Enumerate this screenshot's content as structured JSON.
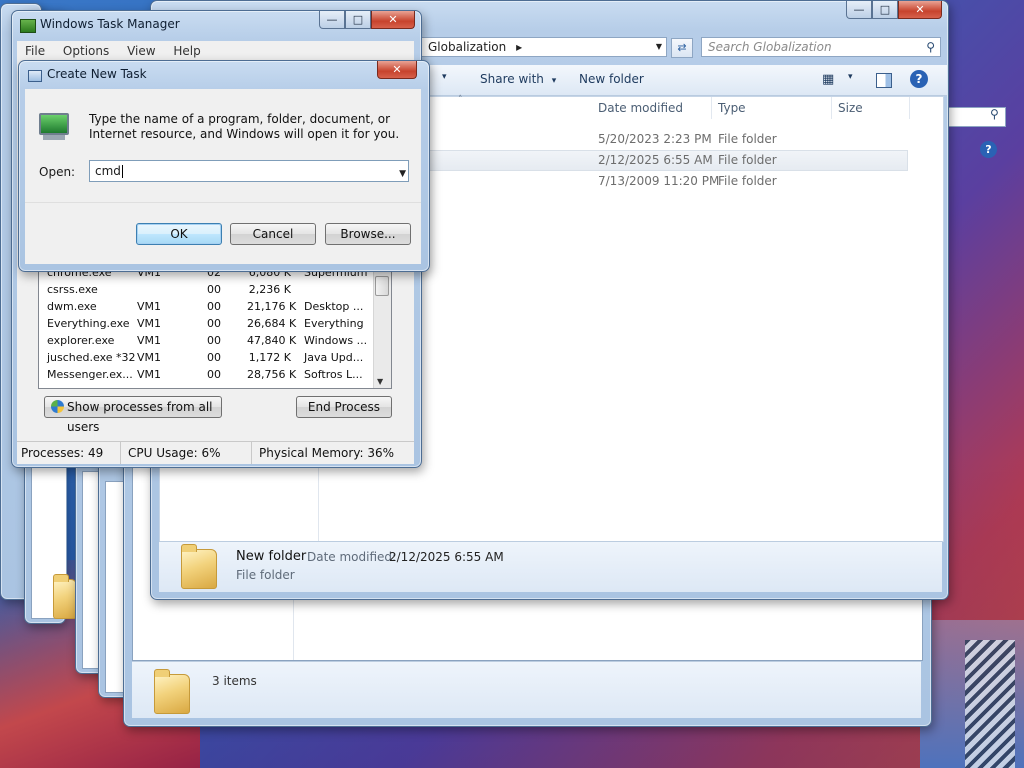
{
  "explorer_back": {
    "status_count": "3 items"
  },
  "explorer_front": {
    "address_crumb": "Globalization",
    "address_arrow": "▸",
    "search_placeholder": "Search Globalization",
    "toolbar": {
      "share_with": "Share with",
      "new_folder": "New folder"
    },
    "columns": {
      "date_modified": "Date modified",
      "type": "Type",
      "size": "Size"
    },
    "rows": [
      {
        "date": "5/20/2023 2:23 PM",
        "type": "File folder"
      },
      {
        "date": "2/12/2025 6:55 AM",
        "type": "File folder"
      },
      {
        "date": "7/13/2009 11:20 PM",
        "type": "File folder"
      }
    ],
    "details": {
      "name": "New folder",
      "date_label": "Date modified:",
      "date_value": "2/12/2025 6:55 AM",
      "kind": "File folder"
    }
  },
  "task_manager": {
    "title": "Windows Task Manager",
    "menu": {
      "file": "File",
      "options": "Options",
      "view": "View",
      "help": "Help"
    },
    "processes": [
      {
        "name": "chrome.exe",
        "user": "VM1",
        "cpu": "02",
        "mem": "6,080 K",
        "desc": "Supermium"
      },
      {
        "name": "csrss.exe",
        "user": "",
        "cpu": "00",
        "mem": "2,236 K",
        "desc": ""
      },
      {
        "name": "dwm.exe",
        "user": "VM1",
        "cpu": "00",
        "mem": "21,176 K",
        "desc": "Desktop ..."
      },
      {
        "name": "Everything.exe",
        "user": "VM1",
        "cpu": "00",
        "mem": "26,684 K",
        "desc": "Everything"
      },
      {
        "name": "explorer.exe",
        "user": "VM1",
        "cpu": "00",
        "mem": "47,840 K",
        "desc": "Windows ..."
      },
      {
        "name": "jusched.exe *32",
        "user": "VM1",
        "cpu": "00",
        "mem": "1,172 K",
        "desc": "Java Upd..."
      },
      {
        "name": "Messenger.ex...",
        "user": "VM1",
        "cpu": "00",
        "mem": "28,756 K",
        "desc": "Softros L..."
      }
    ],
    "show_all_label": "Show processes from all users",
    "end_process_label": "End Process",
    "status": {
      "processes": "Processes: 49",
      "cpu": "CPU Usage: 6%",
      "memory": "Physical Memory: 36%"
    }
  },
  "create_task": {
    "title": "Create New Task",
    "message": "Type the name of a program, folder, document, or Internet resource, and Windows will open it for you.",
    "open_label": "Open:",
    "open_value": "cmd",
    "ok_label": "OK",
    "cancel_label": "Cancel",
    "browse_label": "Browse..."
  },
  "icons": {
    "close": "✕",
    "maximize": "□",
    "minimize": "—",
    "dropdown": "▼",
    "search": "🔍",
    "help": "?"
  }
}
